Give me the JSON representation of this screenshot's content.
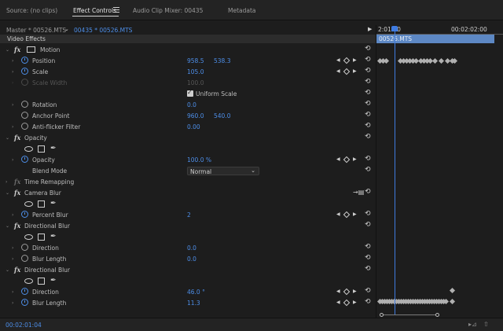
{
  "tabs": [
    {
      "label": "Source: (no clips)"
    },
    {
      "label": "Effect Controls"
    },
    {
      "label": "Audio Clip Mixer: 00435"
    },
    {
      "label": "Metadata"
    }
  ],
  "master": {
    "label": "Master * 00526.MTS",
    "clip": "00435 * 00526.MTS"
  },
  "section": {
    "label": "Video Effects"
  },
  "motion": {
    "name": "Motion",
    "position": {
      "label": "Position",
      "x": "958.5",
      "y": "538.3"
    },
    "scale": {
      "label": "Scale",
      "value": "105.0"
    },
    "scale_width": {
      "label": "Scale Width",
      "value": "100.0"
    },
    "uniform_scale": {
      "label": "Uniform Scale",
      "checked": true
    },
    "rotation": {
      "label": "Rotation",
      "value": "0.0"
    },
    "anchor": {
      "label": "Anchor Point",
      "x": "960.0",
      "y": "540.0"
    },
    "antiflicker": {
      "label": "Anti-flicker Filter",
      "value": "0.00"
    }
  },
  "opacity": {
    "name": "Opacity",
    "opacity": {
      "label": "Opacity",
      "value": "100.0 %"
    },
    "blend": {
      "label": "Blend Mode",
      "value": "Normal"
    }
  },
  "time_remap": {
    "name": "Time Remapping"
  },
  "camera_blur": {
    "name": "Camera Blur",
    "percent": {
      "label": "Percent Blur",
      "value": "2"
    }
  },
  "dir_blur_1": {
    "name": "Directional Blur",
    "direction": {
      "label": "Direction",
      "value": "0.0"
    },
    "length": {
      "label": "Blur Length",
      "value": "0.0"
    }
  },
  "dir_blur_2": {
    "name": "Directional Blur",
    "direction": {
      "label": "Direction",
      "value": "46.0 °"
    },
    "length": {
      "label": "Blur Length",
      "value": "11.3"
    }
  },
  "timeline": {
    "time_start": "2:01:00",
    "time_end": "00:02:02:00",
    "clip_name": "00526.MTS"
  },
  "status": {
    "timecode": "00:02:01:04"
  },
  "colors": {
    "accent": "#4d8ee8",
    "clip": "#5d88c4",
    "playhead": "#3f7be0"
  }
}
